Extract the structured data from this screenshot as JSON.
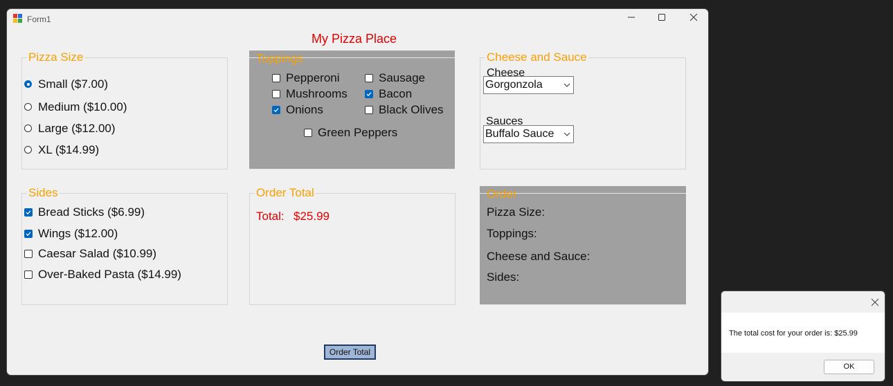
{
  "window": {
    "title": "Form1"
  },
  "form_title": "My Pizza Place",
  "pizza_size": {
    "legend": "Pizza Size",
    "options": [
      {
        "label": "Small ($7.00)",
        "selected": true
      },
      {
        "label": "Medium ($10.00)",
        "selected": false
      },
      {
        "label": "Large ($12.00)",
        "selected": false
      },
      {
        "label": "XL ($14.99)",
        "selected": false
      }
    ]
  },
  "toppings": {
    "legend": "Toppings",
    "items": [
      {
        "label": "Pepperoni",
        "checked": false
      },
      {
        "label": "Sausage",
        "checked": false
      },
      {
        "label": "Mushrooms",
        "checked": false
      },
      {
        "label": "Bacon",
        "checked": true
      },
      {
        "label": "Onions",
        "checked": true
      },
      {
        "label": "Black Olives",
        "checked": false
      },
      {
        "label": "Green Peppers",
        "checked": false
      }
    ]
  },
  "cheese_sauce": {
    "legend": "Cheese and Sauce",
    "cheese_label": "Cheese",
    "cheese_value": "Gorgonzola",
    "sauce_label": "Sauces",
    "sauce_value": "Buffalo Sauce"
  },
  "sides": {
    "legend": "Sides",
    "items": [
      {
        "label": "Bread Sticks ($6.99)",
        "checked": true
      },
      {
        "label": "Wings ($12.00)",
        "checked": true
      },
      {
        "label": "Caesar Salad ($10.99)",
        "checked": false
      },
      {
        "label": "Over-Baked Pasta ($14.99)",
        "checked": false
      }
    ]
  },
  "order_total": {
    "legend": "Order Total",
    "total_label": "Total:",
    "total_value": "$25.99"
  },
  "order": {
    "legend": "Order",
    "lines": [
      "Pizza Size:",
      "Toppings:",
      "Cheese and Sauce:",
      "Sides:"
    ]
  },
  "button_order_total": "Order Total",
  "message_box": {
    "text": "The total cost for your order is: $25.99",
    "ok": "OK"
  },
  "colors": {
    "legend": "#f7a000",
    "title_red": "#e00000",
    "accent": "#0067c0",
    "panel_gray": "#a0a0a0",
    "button_blue": "#9fb6d6"
  }
}
